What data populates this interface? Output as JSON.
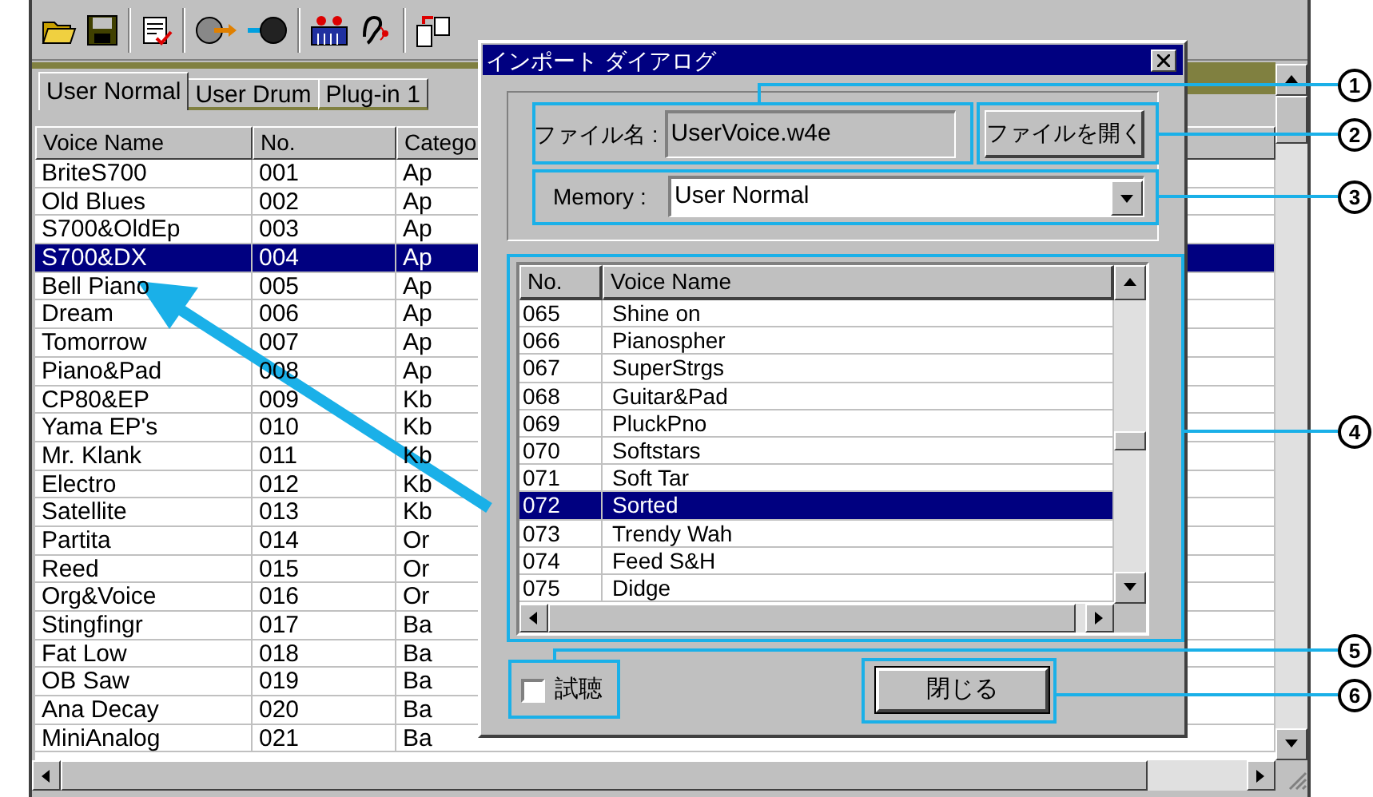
{
  "tabs": [
    {
      "label": "User Normal",
      "selected": true
    },
    {
      "label": "User Drum",
      "selected": false
    },
    {
      "label": "Plug-in 1",
      "selected": false
    }
  ],
  "voice_table": {
    "columns": [
      "Voice Name",
      "No.",
      "Catego"
    ],
    "rows": [
      {
        "cells": [
          "BriteS700",
          "001",
          "Ap"
        ],
        "selected": false
      },
      {
        "cells": [
          "Old Blues",
          "002",
          "Ap"
        ],
        "selected": false
      },
      {
        "cells": [
          "S700&OldEp",
          "003",
          "Ap"
        ],
        "selected": false
      },
      {
        "cells": [
          "S700&DX",
          "004",
          "Ap"
        ],
        "selected": true
      },
      {
        "cells": [
          "Bell Piano",
          "005",
          "Ap"
        ],
        "selected": false
      },
      {
        "cells": [
          "Dream",
          "006",
          "Ap"
        ],
        "selected": false
      },
      {
        "cells": [
          "Tomorrow",
          "007",
          "Ap"
        ],
        "selected": false
      },
      {
        "cells": [
          "Piano&Pad",
          "008",
          "Ap"
        ],
        "selected": false
      },
      {
        "cells": [
          "CP80&EP",
          "009",
          "Kb"
        ],
        "selected": false
      },
      {
        "cells": [
          "Yama EP's",
          "010",
          "Kb"
        ],
        "selected": false
      },
      {
        "cells": [
          "Mr. Klank",
          "011",
          "Kb"
        ],
        "selected": false
      },
      {
        "cells": [
          "Electro",
          "012",
          "Kb"
        ],
        "selected": false
      },
      {
        "cells": [
          "Satellite",
          "013",
          "Kb"
        ],
        "selected": false
      },
      {
        "cells": [
          "Partita",
          "014",
          "Or"
        ],
        "selected": false
      },
      {
        "cells": [
          "Reed",
          "015",
          "Or"
        ],
        "selected": false
      },
      {
        "cells": [
          "Org&Voice",
          "016",
          "Or"
        ],
        "selected": false
      },
      {
        "cells": [
          "Stingfingr",
          "017",
          "Ba"
        ],
        "selected": false
      },
      {
        "cells": [
          "Fat Low",
          "018",
          "Ba"
        ],
        "selected": false
      },
      {
        "cells": [
          "OB Saw",
          "019",
          "Ba"
        ],
        "selected": false
      },
      {
        "cells": [
          "Ana Decay",
          "020",
          "Ba"
        ],
        "selected": false
      },
      {
        "cells": [
          "MiniAnalog",
          "021",
          "Ba"
        ],
        "selected": false
      }
    ]
  },
  "dialog": {
    "title": "インポート ダイアログ",
    "file_label": "ファイル名 :",
    "file_value": "UserVoice.w4e",
    "open_button": "ファイルを開く",
    "memory_label": "Memory :",
    "memory_value": "User Normal",
    "list": {
      "columns": [
        "No.",
        "Voice Name"
      ],
      "rows": [
        {
          "cells": [
            "065",
            "Shine on"
          ],
          "selected": false
        },
        {
          "cells": [
            "066",
            "Pianospher"
          ],
          "selected": false
        },
        {
          "cells": [
            "067",
            "SuperStrgs"
          ],
          "selected": false
        },
        {
          "cells": [
            "068",
            "Guitar&Pad"
          ],
          "selected": false
        },
        {
          "cells": [
            "069",
            "PluckPno"
          ],
          "selected": false
        },
        {
          "cells": [
            "070",
            "Softstars"
          ],
          "selected": false
        },
        {
          "cells": [
            "071",
            "Soft Tar"
          ],
          "selected": false
        },
        {
          "cells": [
            "072",
            "Sorted"
          ],
          "selected": true
        },
        {
          "cells": [
            "073",
            "Trendy Wah"
          ],
          "selected": false
        },
        {
          "cells": [
            "074",
            "Feed S&H"
          ],
          "selected": false
        },
        {
          "cells": [
            "075",
            "Didge"
          ],
          "selected": false
        }
      ]
    },
    "audition": {
      "label": "試聴",
      "checked": false
    },
    "close_button": "閉じる"
  },
  "callouts": [
    "1",
    "2",
    "3",
    "4",
    "5",
    "6"
  ]
}
